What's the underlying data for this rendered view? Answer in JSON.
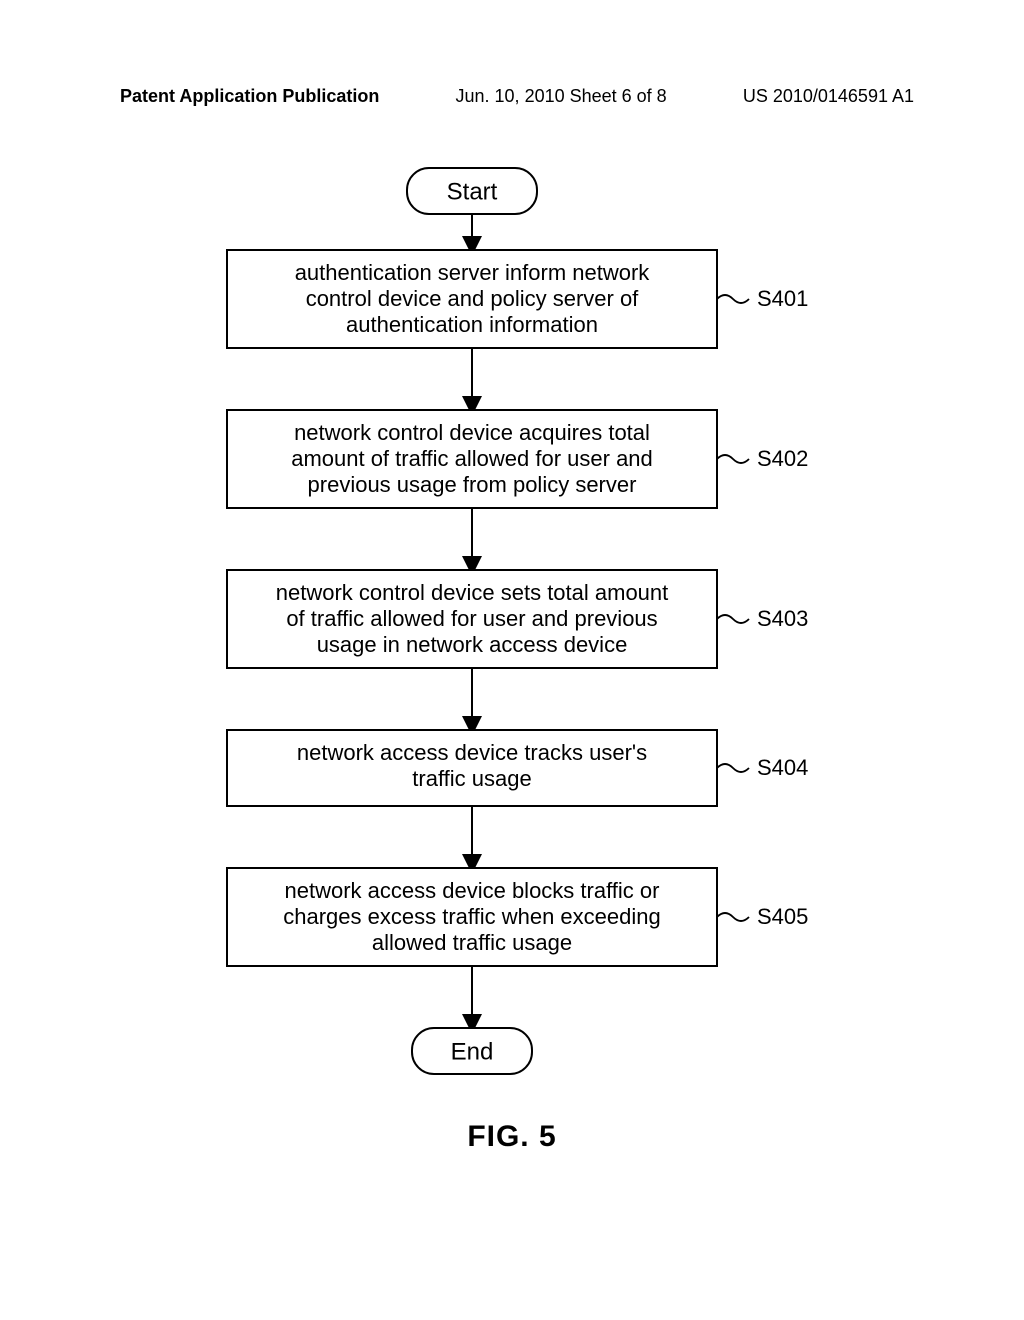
{
  "header": {
    "left": "Patent Application Publication",
    "mid": "Jun. 10, 2010  Sheet 6 of 8",
    "right": "US 2010/0146591 A1"
  },
  "chart_data": {
    "type": "flowchart",
    "start": "Start",
    "end": "End",
    "steps": [
      {
        "id": "S401",
        "lines": [
          "authentication server inform network",
          "control device and policy server of",
          "authentication information"
        ]
      },
      {
        "id": "S402",
        "lines": [
          "network control device acquires total",
          "amount of traffic allowed for user and",
          "previous usage from policy server"
        ]
      },
      {
        "id": "S403",
        "lines": [
          "network control device sets total amount",
          "of traffic allowed for user and previous",
          "usage in network access device"
        ]
      },
      {
        "id": "S404",
        "lines": [
          "network access device tracks user's",
          "traffic usage"
        ]
      },
      {
        "id": "S405",
        "lines": [
          "network access device blocks traffic or",
          "charges excess traffic when exceeding",
          "allowed traffic usage"
        ]
      }
    ],
    "figure_label": "FIG. 5"
  }
}
